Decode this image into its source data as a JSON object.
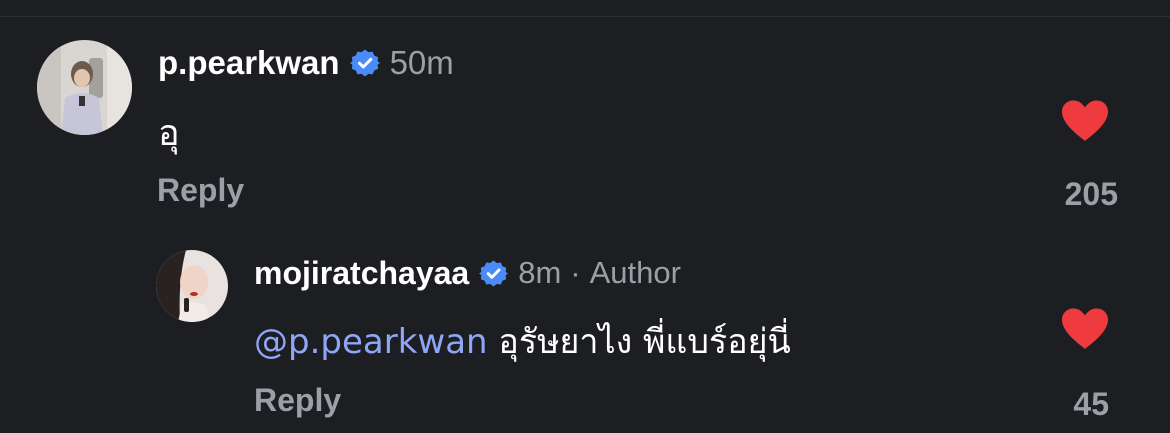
{
  "comments": [
    {
      "username": "p.pearkwan",
      "verified": true,
      "timestamp": "50m",
      "text": "อุ",
      "reply_label": "Reply",
      "like_count": "205",
      "liked": true
    }
  ],
  "reply_comment": {
    "username": "mojiratchayaa",
    "verified": true,
    "timestamp": "8m",
    "separator": "·",
    "author_label": "Author",
    "mention": "@p.pearkwan",
    "text": "อุรัษยาไง พี่แบร์อยุ่นี่",
    "reply_label": "Reply",
    "like_count": "45",
    "liked": true
  },
  "colors": {
    "background": "#1c1e21",
    "text_primary": "#ffffff",
    "text_secondary": "#9aa0a6",
    "mention": "#8ea6f5",
    "verified_badge": "#4a8cf7",
    "heart": "#ef3b3f"
  },
  "icons": {
    "verified": "verified-badge-icon",
    "like": "heart-icon"
  }
}
